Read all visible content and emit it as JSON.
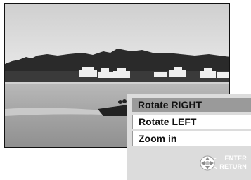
{
  "menu": {
    "items": [
      {
        "label": "Rotate RIGHT",
        "selected": true
      },
      {
        "label": "Rotate LEFT",
        "selected": false
      },
      {
        "label": "Zoom in",
        "selected": false
      }
    ]
  },
  "hints": {
    "enter": "ENTER",
    "return": "RETURN"
  },
  "icons": {
    "navigation": "dpad-icon"
  },
  "colors": {
    "panel_bg": "#dcdcdc",
    "highlight": "#9a9a9a",
    "item_bg": "#ffffff"
  }
}
